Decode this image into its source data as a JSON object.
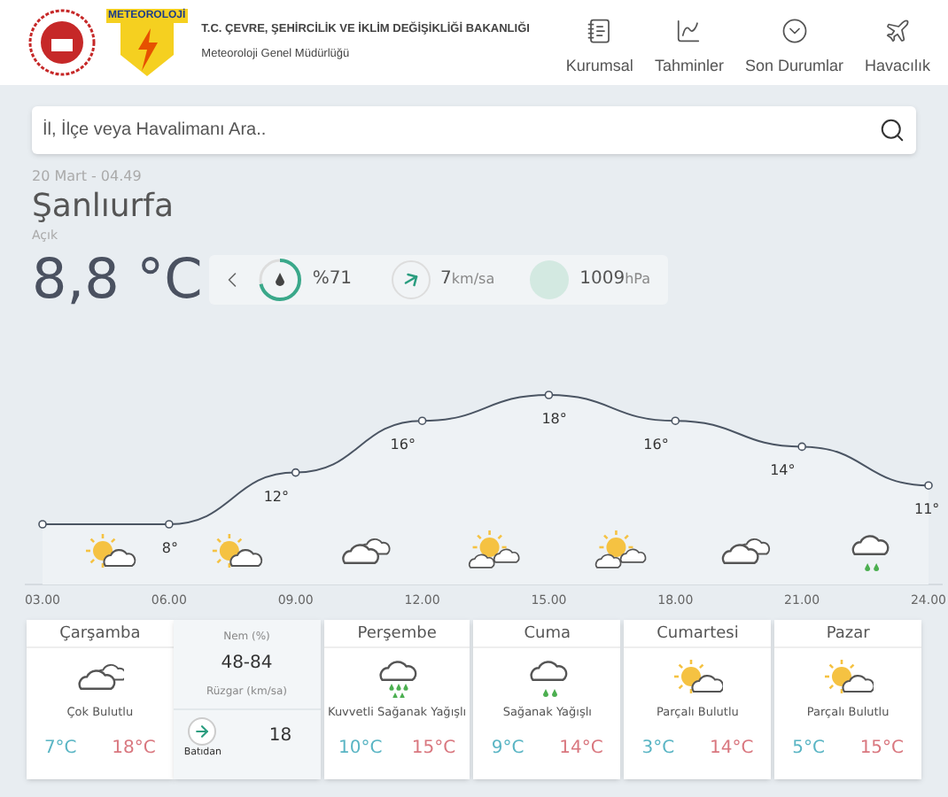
{
  "header": {
    "logo_text": "METEOROLOJİ",
    "ministry": "T.C. ÇEVRE, ŞEHİRCİLİK VE İKLİM DEĞİŞİKLİĞİ BAKANLIĞI",
    "directorate": "Meteoroloji Genel Müdürlüğü"
  },
  "nav": [
    {
      "label": "Kurumsal",
      "kind": "document"
    },
    {
      "label": "Tahminler",
      "kind": "chart"
    },
    {
      "label": "Son Durumlar",
      "kind": "chevron"
    },
    {
      "label": "Havacılık",
      "kind": "plane"
    }
  ],
  "search": {
    "placeholder": "İl, İlçe veya Havalimanı Ara.."
  },
  "current": {
    "datetime": "20 Mart - 04.49",
    "city": "Şanlıurfa",
    "condition": "Açık",
    "temperature": "8,8 °C",
    "humidity": {
      "value": "%71",
      "level": 0.71
    },
    "wind": {
      "value": "7",
      "unit": "km/sa"
    },
    "pressure": {
      "value": "1009",
      "unit": "hPa"
    }
  },
  "hourly": {
    "chart_data": {
      "type": "area",
      "categories": [
        "03.00",
        "06.00",
        "09.00",
        "12.00",
        "15.00",
        "18.00",
        "21.00",
        "24.00"
      ],
      "series": [
        {
          "color": "#4b5563",
          "marker": "o",
          "values": [
            8,
            8,
            12,
            16,
            18,
            16,
            14,
            11
          ],
          "value_labels": [
            null,
            "8°",
            "12°",
            "16°",
            "18°",
            "16°",
            "14°",
            "11°"
          ]
        }
      ]
    },
    "icons": [
      {
        "kind": "sun-cloud"
      },
      {
        "kind": "sun-cloud"
      },
      {
        "kind": "cloudy"
      },
      {
        "kind": "sun-clouds"
      },
      {
        "kind": "sun-clouds"
      },
      {
        "kind": "cloudy"
      },
      {
        "kind": "rain"
      }
    ]
  },
  "days": [
    {
      "day": "Çarşamba",
      "kind": "cloudy",
      "condition": "Çok Bulutlu",
      "min": "7°C",
      "max": "18°C",
      "details": {
        "humidity_label": "Nem (%)",
        "humidity": "48-84",
        "wind_label": "Rüzgar (km/sa)",
        "wind_direction": "Batıdan",
        "wind_speed": "18"
      }
    },
    {
      "day": "Perşembe",
      "kind": "heavy-rain",
      "condition": "Kuvvetli Sağanak Yağışlı",
      "min": "10°C",
      "max": "15°C"
    },
    {
      "day": "Cuma",
      "kind": "rain",
      "condition": "Sağanak Yağışlı",
      "min": "9°C",
      "max": "14°C"
    },
    {
      "day": "Cumartesi",
      "kind": "sun-cloud",
      "condition": "Parçalı Bulutlu",
      "min": "3°C",
      "max": "14°C"
    },
    {
      "day": "Pazar",
      "kind": "sun-cloud",
      "condition": "Parçalı Bulutlu",
      "min": "5°C",
      "max": "15°C"
    }
  ]
}
